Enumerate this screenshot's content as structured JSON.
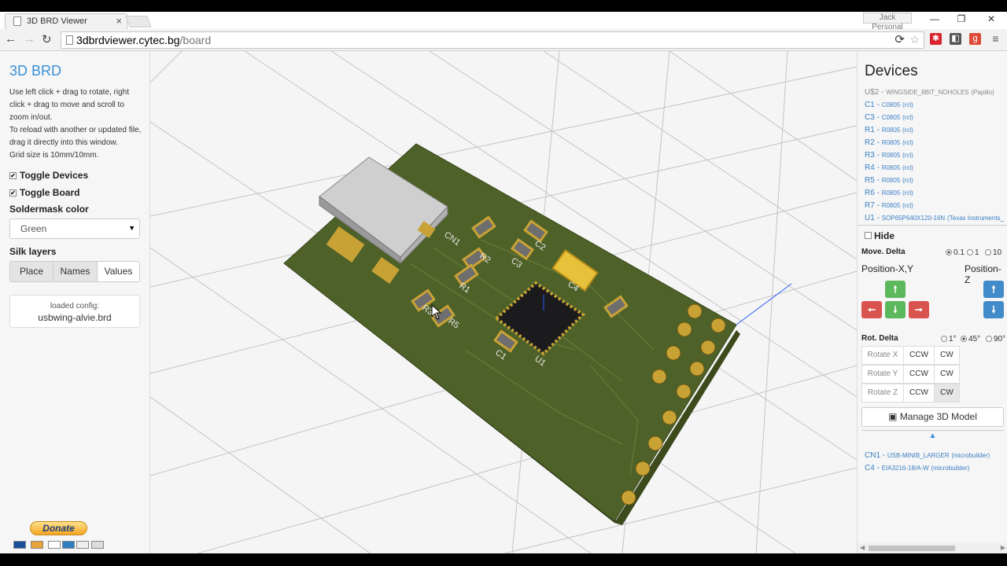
{
  "browser": {
    "tab_title": "3D BRD Viewer",
    "profile": "Jack Personal",
    "url_host": "3dbrdviewer.cytec.bg",
    "url_path": "/board"
  },
  "left_panel": {
    "title": "3D BRD",
    "instructions": [
      "Use left click + drag to rotate, right",
      "click + drag to move and scroll to",
      "zoom in/out.",
      "To reload with another or updated file,",
      "drag it directly into this window.",
      "Grid size is 10mm/10mm."
    ],
    "toggle_devices": "Toggle Devices",
    "toggle_board": "Toggle Board",
    "soldermask_heading": "Soldermask color",
    "soldermask_value": "Green",
    "silk_heading": "Silk layers",
    "silk_buttons": [
      "Place",
      "Names",
      "Values"
    ],
    "config_label": "loaded config:",
    "config_file": "usbwing-alvie.brd",
    "donate_label": "Donate"
  },
  "board": {
    "silk_labels": [
      "CN1",
      "R2",
      "R1",
      "C3",
      "C2",
      "R3",
      "R5",
      "C1",
      "U1",
      "C4"
    ]
  },
  "right_panel": {
    "title": "Devices",
    "devices": [
      {
        "name": "U$2",
        "pkg": "WINGSIDE_8BIT_NOHOLES",
        "lib": "(Papilio)"
      },
      {
        "name": "C1",
        "pkg": "C0805",
        "lib": "(rcl)"
      },
      {
        "name": "C3",
        "pkg": "C0805",
        "lib": "(rcl)"
      },
      {
        "name": "R1",
        "pkg": "R0805",
        "lib": "(rcl)"
      },
      {
        "name": "R2",
        "pkg": "R0805",
        "lib": "(rcl)"
      },
      {
        "name": "R3",
        "pkg": "R0805",
        "lib": "(rcl)"
      },
      {
        "name": "R4",
        "pkg": "R0805",
        "lib": "(rcl)"
      },
      {
        "name": "R5",
        "pkg": "R0805",
        "lib": "(rcl)"
      },
      {
        "name": "R6",
        "pkg": "R0805",
        "lib": "(rcl)"
      },
      {
        "name": "R7",
        "pkg": "R0805",
        "lib": "(rcl)"
      },
      {
        "name": "U1",
        "pkg": "SOP65P640X120-16N",
        "lib": "(Texas Instruments_"
      }
    ],
    "hide_label": "Hide",
    "move_delta_label": "Move. Delta",
    "move_delta_options": [
      "0.1",
      "1",
      "10"
    ],
    "position_xy_label": "Position-X,Y",
    "position_z_label": "Position-Z",
    "rot_delta_label": "Rot. Delta",
    "rot_delta_options": [
      "1°",
      "45°",
      "90°"
    ],
    "rotate_rows": [
      {
        "label": "Rotate X",
        "ccw": "CCW",
        "cw": "CW"
      },
      {
        "label": "Rotate Y",
        "ccw": "CCW",
        "cw": "CW"
      },
      {
        "label": "Rotate Z",
        "ccw": "CCW",
        "cw": "CW"
      }
    ],
    "manage_label": "Manage 3D Model",
    "selected_devices": [
      {
        "name": "CN1",
        "pkg": "USB-MINIB_LARGER",
        "lib": "(microbuilder)"
      },
      {
        "name": "C4",
        "pkg": "EIA3216-18/A-W",
        "lib": "(microbuilder)"
      }
    ]
  },
  "colors": {
    "accent": "#3a8fd6",
    "board_green": "#4d6128",
    "pad_gold": "#c9a236",
    "button_green": "#5cb85c",
    "button_red": "#d9534f",
    "button_blue": "#428bca"
  }
}
